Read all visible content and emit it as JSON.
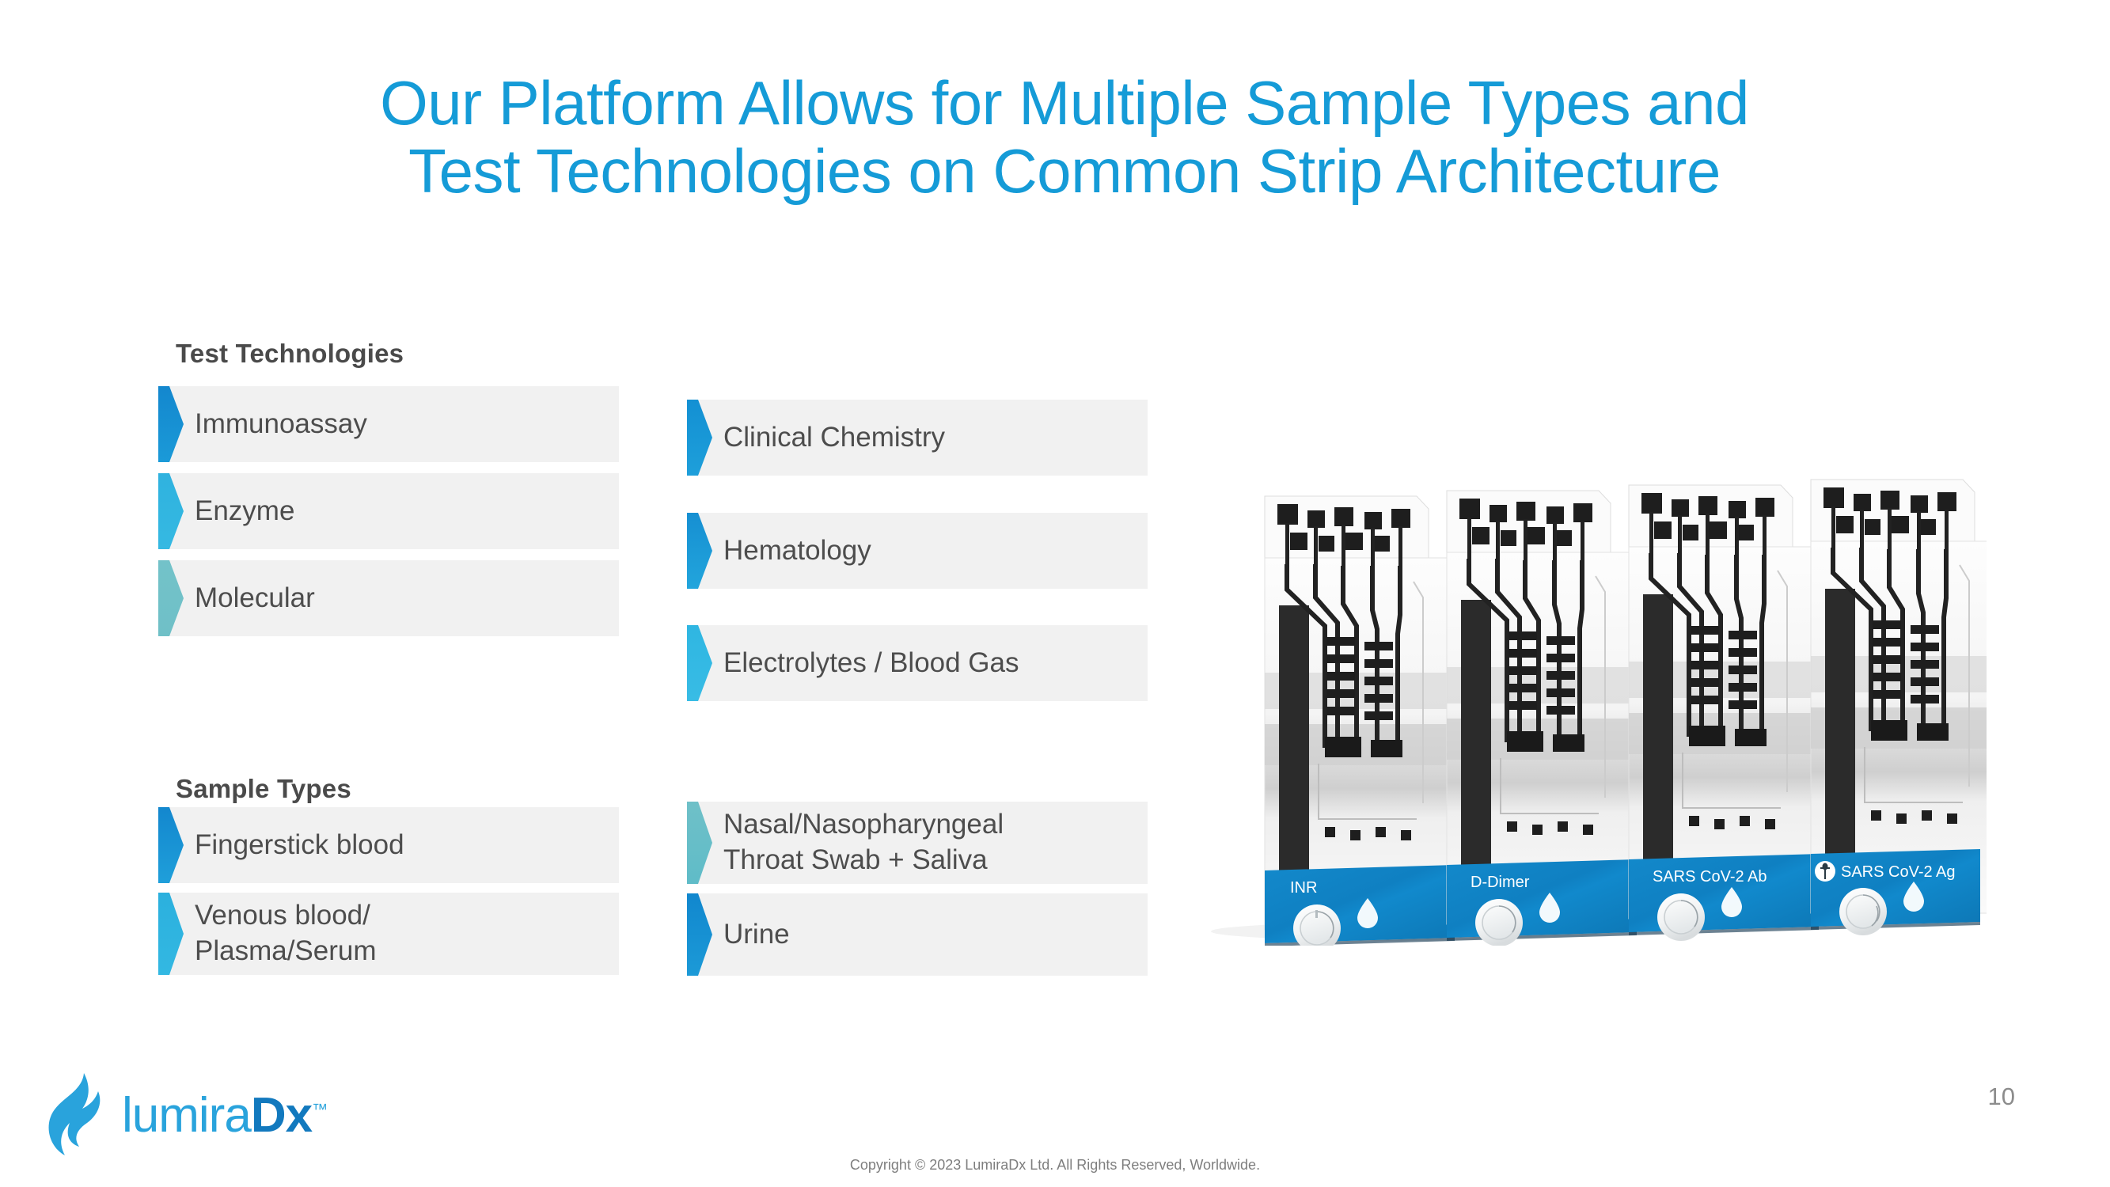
{
  "slide": {
    "title": "Our Platform Allows for Multiple Sample Types and\nTest Technologies on Common Strip Architecture",
    "page_number": "10",
    "copyright": "Copyright © 2023 LumiraDx Ltd. All Rights Reserved, Worldwide.",
    "title_color": "#159BD7",
    "box_background": "#F1F1F1",
    "body_text_color": "#4D4D4D",
    "heading_text_color": "#4A4A4A"
  },
  "brand": {
    "name_light": "lumira",
    "name_bold": "Dx",
    "trademark": "™",
    "flame_color": "#29A3DC",
    "wordmark_light_color": "#29A3DC",
    "wordmark_bold_color": "#1279BE"
  },
  "sections": [
    {
      "id": "test-technologies",
      "heading": "Test Technologies",
      "left_items": [
        {
          "label": "Immunoassay",
          "arrow_color_top": "#1387CE",
          "arrow_color_bottom": "#1B9AD8"
        },
        {
          "label": "Enzyme",
          "arrow_color_top": "#2FB2DF",
          "arrow_color_bottom": "#35B9E2"
        },
        {
          "label": "Molecular",
          "arrow_color_top": "#73C2C9",
          "arrow_color_bottom": "#6FC0C7"
        }
      ],
      "right_items": [
        {
          "label": "Clinical Chemistry",
          "arrow_color_top": "#1390D3",
          "arrow_color_bottom": "#1E9FDA"
        },
        {
          "label": "Hematology",
          "arrow_color_top": "#168FD2",
          "arrow_color_bottom": "#22A5DC"
        },
        {
          "label": "Electrolytes / Blood Gas",
          "arrow_color_top": "#2FB6E2",
          "arrow_color_bottom": "#38BCE5"
        }
      ]
    },
    {
      "id": "sample-types",
      "heading": "Sample Types",
      "left_items": [
        {
          "label": "Fingerstick blood",
          "arrow_color_top": "#1387CE",
          "arrow_color_bottom": "#1F9FDA"
        },
        {
          "label": "Venous blood/\nPlasma/Serum",
          "arrow_color_top": "#2BB0DE",
          "arrow_color_bottom": "#33B8E2"
        }
      ],
      "right_items": [
        {
          "label": "Nasal/Nasopharyngeal\nThroat Swab + Saliva",
          "arrow_color_top": "#6FC0C8",
          "arrow_color_bottom": "#5FBCC8"
        },
        {
          "label": "Urine",
          "arrow_color_top": "#1187CE",
          "arrow_color_bottom": "#1C9AD7"
        }
      ]
    }
  ],
  "strips": {
    "panel_color": "#1083C4",
    "panel_color_dark": "#0E79B8",
    "label_text_color": "#FFFFFF",
    "items": [
      {
        "label": "INR",
        "has_swab_icon": false
      },
      {
        "label": "D-Dimer",
        "has_swab_icon": false
      },
      {
        "label": "SARS CoV-2 Ab",
        "has_swab_icon": false
      },
      {
        "label": "SARS CoV-2 Ag",
        "has_swab_icon": true
      }
    ]
  }
}
